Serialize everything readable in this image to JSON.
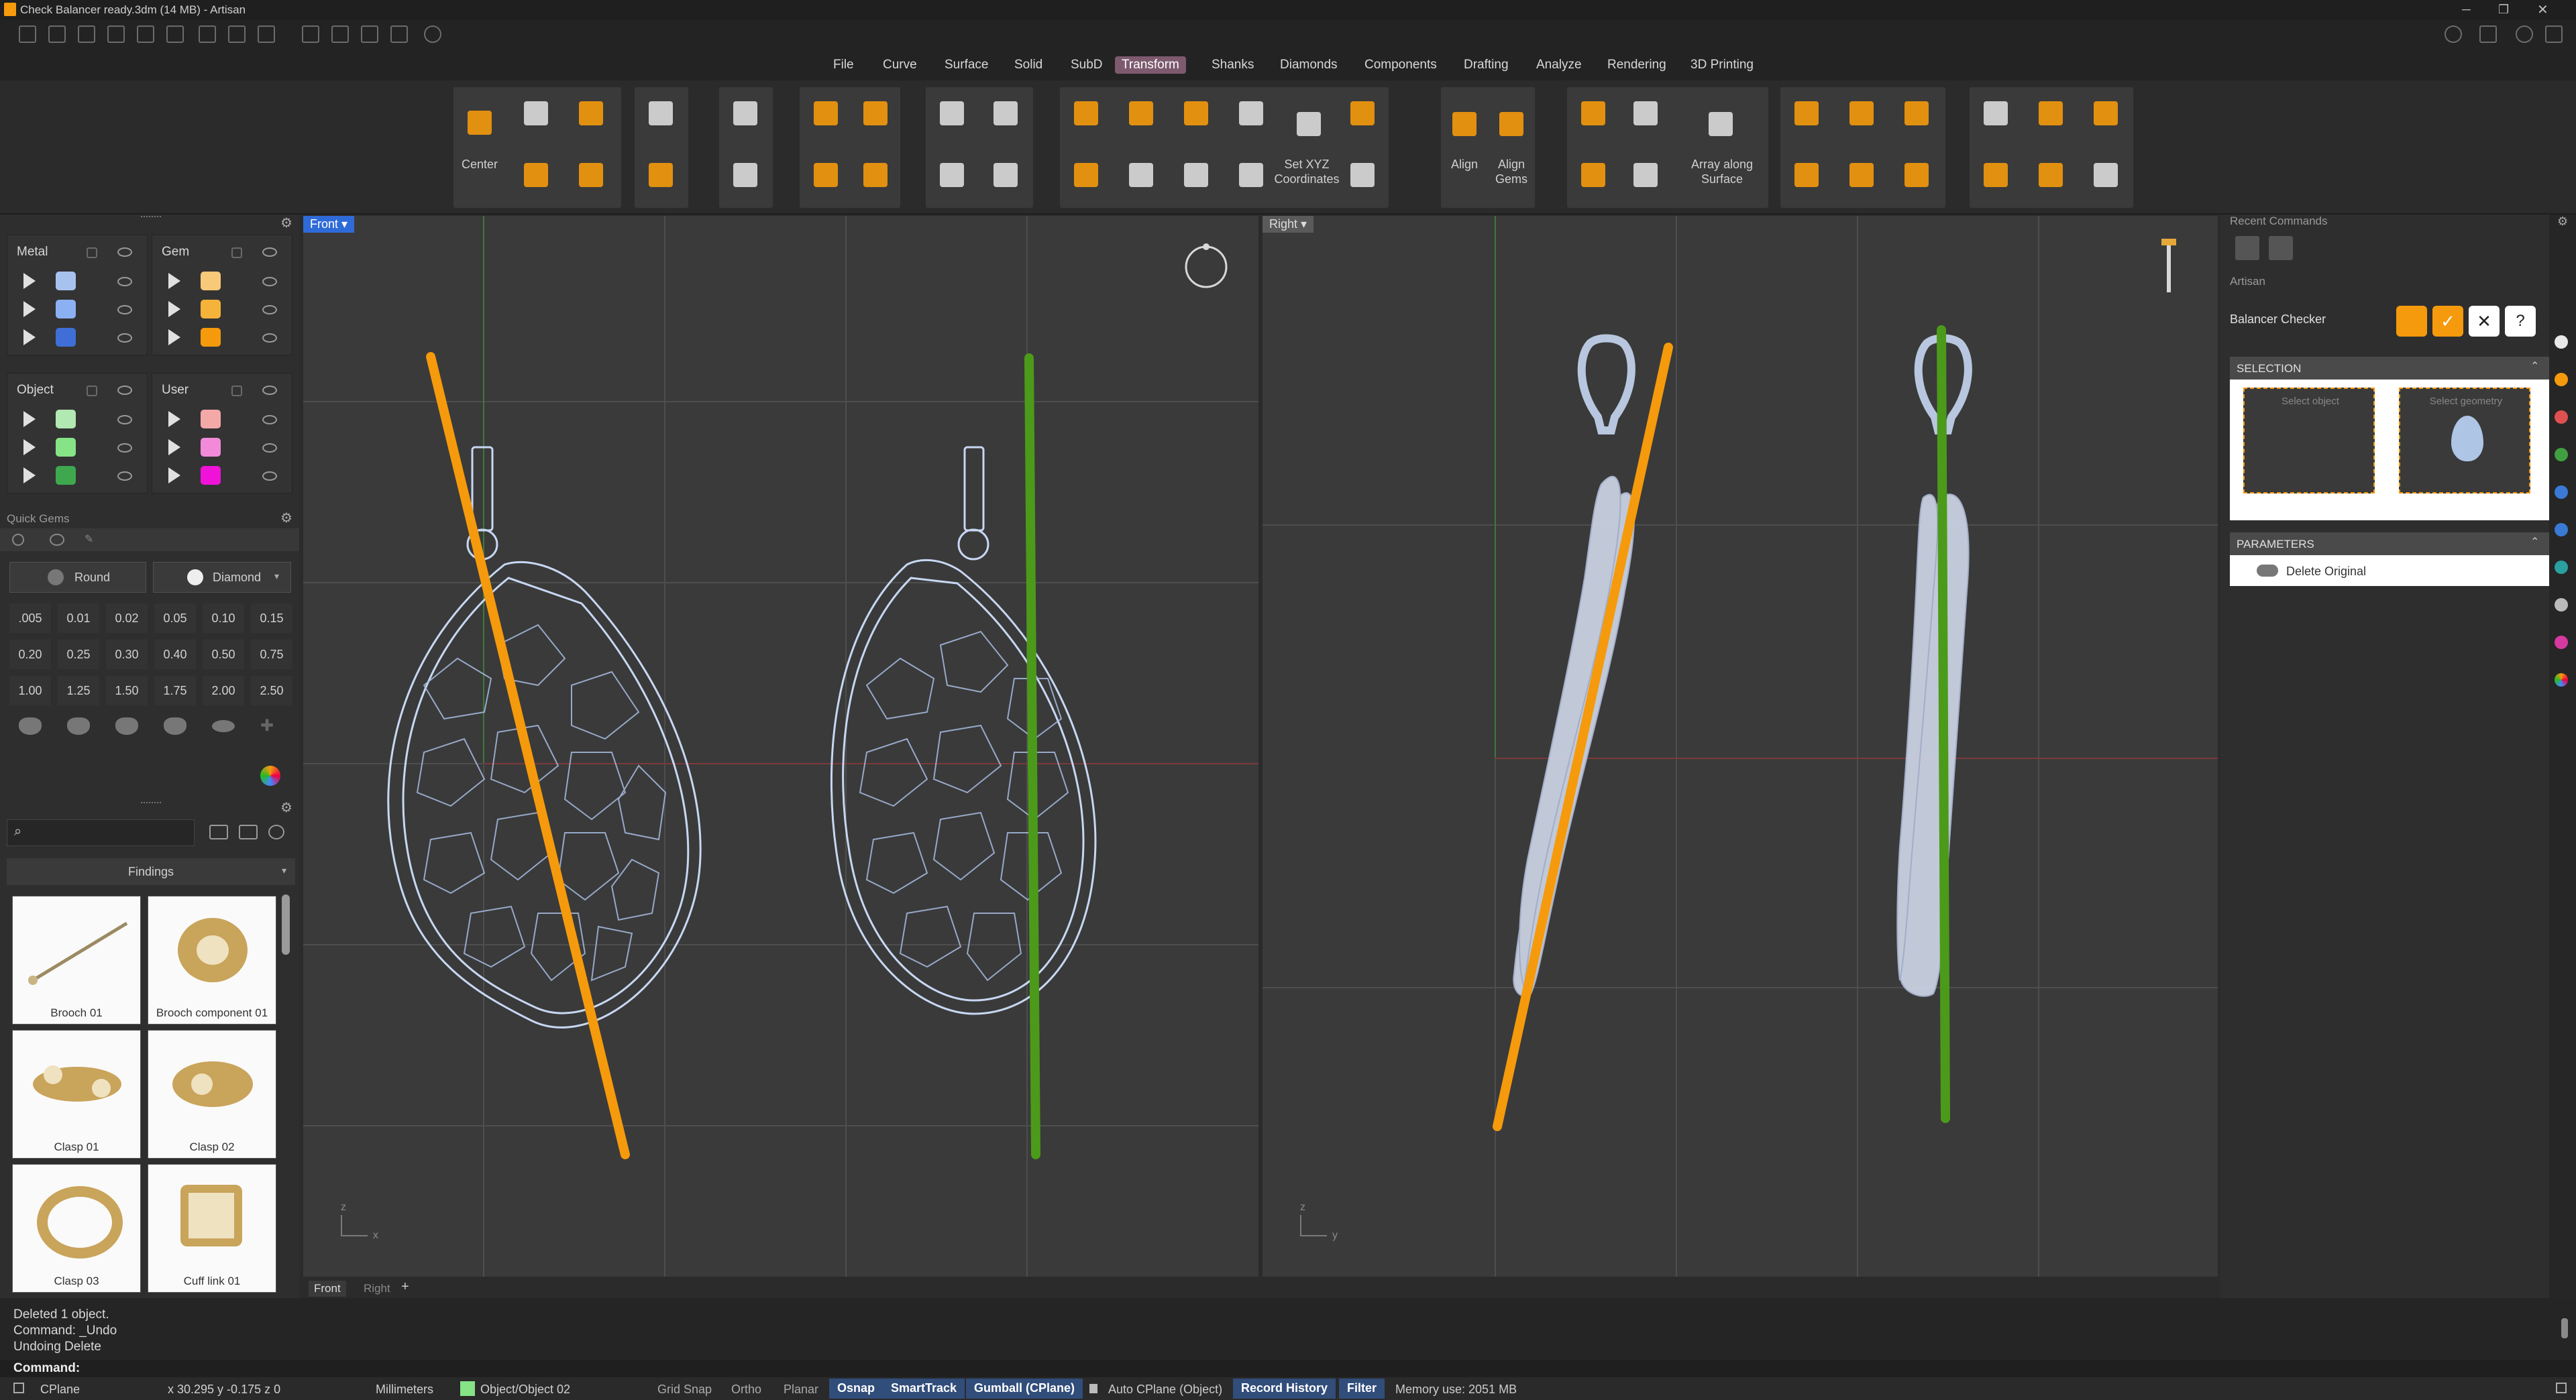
{
  "window": {
    "title": "Check Balancer ready.3dm (14 MB) - Artisan"
  },
  "menu": [
    "File",
    "Curve",
    "Surface",
    "Solid",
    "SubD",
    "Transform",
    "Shanks",
    "Diamonds",
    "Components",
    "Drafting",
    "Analyze",
    "Rendering",
    "3D Printing"
  ],
  "menu_active": "Transform",
  "ribbon": {
    "center": "Center",
    "set_xyz": "Set XYZ\nCoordinates",
    "align": "Align",
    "align_gems": "Align\nGems",
    "array_surface": "Array along\nSurface"
  },
  "layers": {
    "groups": [
      {
        "name": "Metal",
        "colors": [
          "#a8c2f0",
          "#8cb1f2",
          "#3f6fd6"
        ]
      },
      {
        "name": "Gem",
        "colors": [
          "#f7c978",
          "#f5b33a",
          "#f59a0c"
        ]
      },
      {
        "name": "Object",
        "colors": [
          "#b2e8b2",
          "#86e386",
          "#3fa84f"
        ]
      },
      {
        "name": "User",
        "colors": [
          "#f4a9a9",
          "#f28ad9",
          "#f012d8"
        ]
      }
    ]
  },
  "quick_gems": {
    "title": "Quick Gems",
    "shape": "Round",
    "material": "Diamond",
    "sizes": [
      ".005",
      "0.01",
      "0.02",
      "0.05",
      "0.10",
      "0.15",
      "0.20",
      "0.25",
      "0.30",
      "0.40",
      "0.50",
      "0.75",
      "1.00",
      "1.25",
      "1.50",
      "1.75",
      "2.00",
      "2.50"
    ]
  },
  "library": {
    "category": "Findings",
    "items": [
      "Brooch 01",
      "Brooch component 01",
      "Clasp 01",
      "Clasp 02",
      "Clasp 03",
      "Cuff link 01"
    ]
  },
  "viewports": {
    "front": {
      "label": "Front",
      "axis_h": "x",
      "axis_v": "z"
    },
    "right": {
      "label": "Right",
      "axis_h": "y",
      "axis_v": "z"
    },
    "tabs": [
      "Front",
      "Right",
      "+"
    ]
  },
  "right_panel": {
    "recent_commands": "Recent Commands",
    "artisan": "Artisan",
    "command": "Balancer Checker",
    "selection": "SELECTION",
    "select_object": "Select object",
    "select_geometry": "Select geometry",
    "parameters": "PARAMETERS",
    "delete_original": "Delete Original",
    "help": "?"
  },
  "command_history": [
    "Deleted 1 object.",
    "Command: _Undo",
    "Undoing Delete"
  ],
  "command_prompt": "Command:",
  "statusbar": {
    "cplane": "CPlane",
    "coords": "x 30.295  y -0.175  z 0",
    "units": "Millimeters",
    "layer": "Object/Object 02",
    "grid_snap": "Grid Snap",
    "ortho": "Ortho",
    "planar": "Planar",
    "osnap": "Osnap",
    "smarttrack": "SmartTrack",
    "gumball": "Gumball (CPlane)",
    "auto_cplane": "Auto CPlane (Object)",
    "record_history": "Record History",
    "filter": "Filter",
    "memory": "Memory use: 2051 MB"
  },
  "colors": {
    "orange": "#f59a0c",
    "green": "#4c9a1a",
    "active_tab": "#7d5a6e",
    "status_active": "#314d7a"
  }
}
